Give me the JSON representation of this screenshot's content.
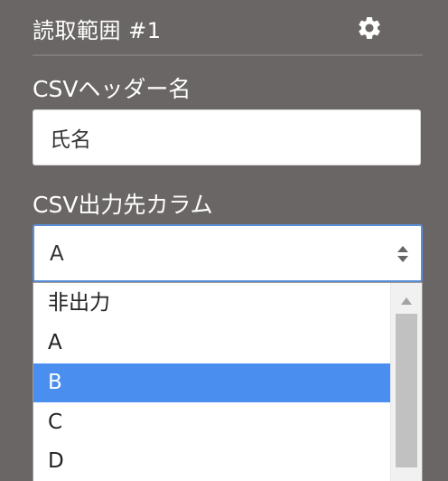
{
  "section": {
    "title": "読取範囲 #1",
    "settings_icon": "gear-icon"
  },
  "csv_header": {
    "label": "CSVヘッダー名",
    "value": "氏名"
  },
  "csv_output": {
    "label": "CSV出力先カラム",
    "selected_value": "A",
    "arrows_icon": "sort-arrows-icon",
    "options": [
      "非出力",
      "A",
      "B",
      "C",
      "D"
    ],
    "highlighted_option": "B"
  },
  "colors": {
    "background": "#6a6665",
    "select_focus_border": "#5c8ed8",
    "highlight": "#4a8ff0"
  }
}
